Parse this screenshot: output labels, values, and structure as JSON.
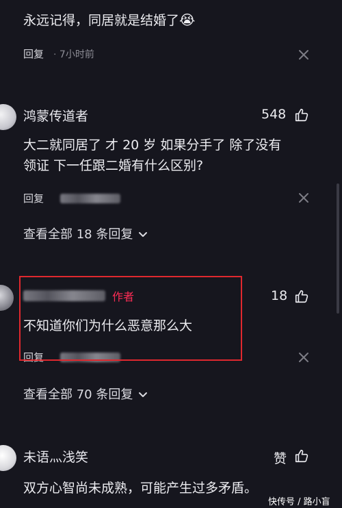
{
  "top_comment": {
    "text": "永远记得，同居就是结婚了",
    "emoji": "😭",
    "reply_label": "回复",
    "separator": "·",
    "time": "7小时前"
  },
  "comments": [
    {
      "name": "鸿蒙传道者",
      "likes": "548",
      "text_line1": "大二就同居了 才 20 岁 如果分手了 除了没有",
      "text_line2": "领证 下一任跟二婚有什么区别?",
      "reply_label": "回复",
      "view_all": "查看全部 18 条回复"
    },
    {
      "author_tag": "作者",
      "likes": "18",
      "text": "不知道你们为什么恶意那么大",
      "reply_label": "回复",
      "view_all": "查看全部 70 条回复"
    },
    {
      "name": "未语灬浅笑",
      "likes": "赞",
      "text": "双方心智尚未成熟，可能产生过多矛盾。"
    }
  ],
  "watermark": "快传号 / 路小盲",
  "colors": {
    "background": "#16161e",
    "author_tag": "#fe2c55",
    "highlight_box": "#e0282e"
  },
  "icons": [
    "close-icon",
    "thumbs-up-icon",
    "chevron-down-icon",
    "avatar"
  ]
}
